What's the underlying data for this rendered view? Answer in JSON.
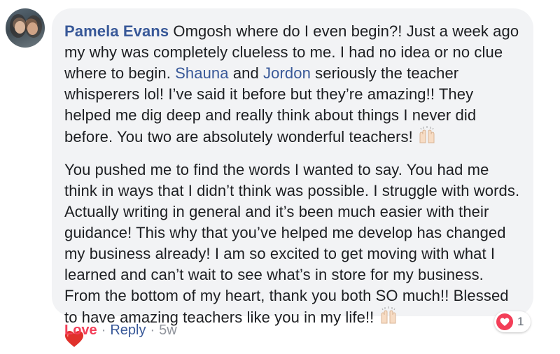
{
  "comment": {
    "author": "Pamela Evans",
    "paragraph1": {
      "intro": " Omgosh where do I even begin?! Just a week ago my why was completely clueless to me. I had no idea or no clue where to begin. ",
      "mention1": "Shauna",
      "and": " and ",
      "mention2": "Jordon",
      "rest": " seriously the teacher whisperers lol! I’ve said it before but they’re amazing!! They helped me dig deep and really think about things I never did before. You two are absolutely wonderful teachers! "
    },
    "paragraph2": {
      "text": "You pushed me to find the words I wanted to say. You had me think in ways that I didn’t think was possible. I struggle with words. Actually writing in general and it’s been much easier with their guidance! This why that you’ve helped me develop has changed my business already! I am so excited to get moving with what I learned and can’t wait to see what’s in store for my business. From the bottom of my heart, thank you both SO much!! Blessed to have amazing teachers like you in my life!! "
    },
    "emoji": {
      "praise": "raised-hands-icon",
      "heart": "red-heart-icon"
    }
  },
  "actions": {
    "love": "Love",
    "separator": "·",
    "reply": "Reply",
    "time": "5w"
  },
  "reactions": {
    "icon": "love-reaction-icon",
    "count": "1"
  },
  "colors": {
    "bubble": "#f2f3f5",
    "link": "#385898",
    "love": "#f33e58",
    "meta": "#90949c"
  }
}
